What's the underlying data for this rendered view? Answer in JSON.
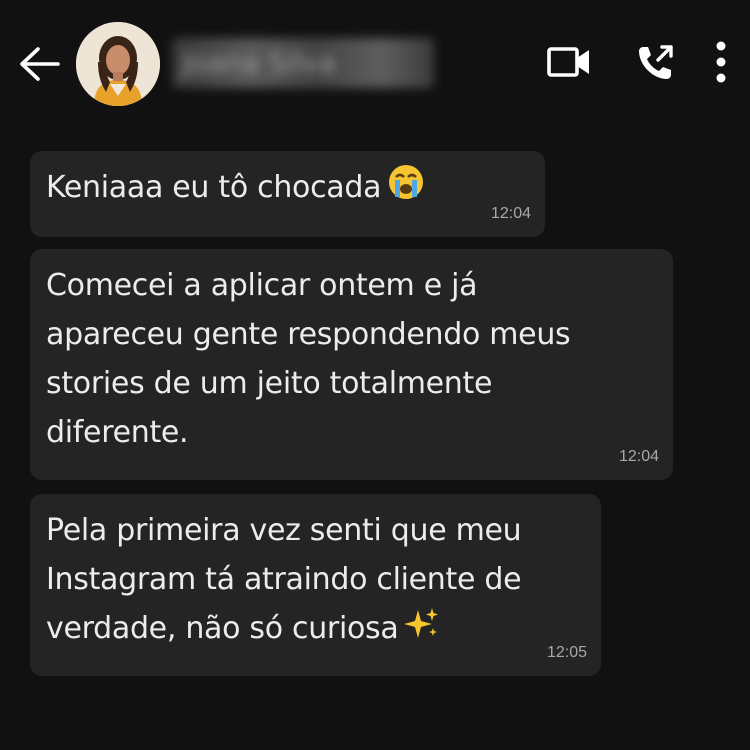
{
  "header": {
    "contact_name": "Joana Silva",
    "back_icon": "arrow-left-icon",
    "video_icon": "video-camera-icon",
    "call_icon": "phone-call-icon",
    "menu_icon": "more-vertical-icon"
  },
  "colors": {
    "background": "#111111",
    "bubble": "#242424",
    "text": "#ececec",
    "timestamp": "#a8a8a8"
  },
  "messages": [
    {
      "text": "Keniaaa eu tô chocada",
      "emoji": "loudly-crying-face-emoji",
      "time": "12:04"
    },
    {
      "text": "Comecei a aplicar ontem e já\napareceu gente respondendo meus\nstories de um jeito totalmente\ndiferente.",
      "time": "12:04"
    },
    {
      "text": "Pela primeira vez senti que meu\nInstagram tá atraindo cliente de\nverdade, não só curiosa",
      "emoji": "sparkles-emoji",
      "time": "12:05"
    }
  ]
}
